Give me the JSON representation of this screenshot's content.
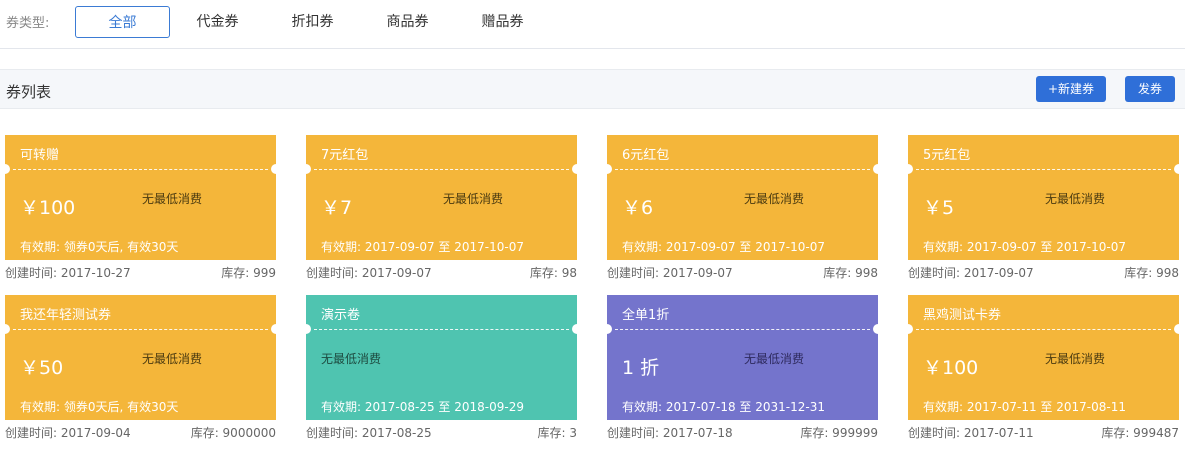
{
  "filter": {
    "label": "券类型:",
    "tabs": [
      "全部",
      "代金券",
      "折扣券",
      "商品券",
      "赠品券"
    ]
  },
  "header": {
    "title": "券列表",
    "new_button": "+新建券",
    "issue_button": "发券"
  },
  "colors": {
    "gold": "#f4b63a",
    "teal": "#4fc4b0",
    "purple": "#7474cc",
    "primary": "#2f6fd8"
  },
  "coupons": [
    {
      "title": "可转赠",
      "amount": "￥100",
      "min_spend": "无最低消费",
      "validity": "有效期:  领券0天后, 有效30天",
      "created": "创建时间: 2017-10-27",
      "stock": "库存: 999",
      "color": "gold"
    },
    {
      "title": "7元红包",
      "amount": "￥7",
      "min_spend": "无最低消费",
      "validity": "有效期:  2017-09-07 至 2017-10-07",
      "created": "创建时间: 2017-09-07",
      "stock": "库存: 98",
      "color": "gold"
    },
    {
      "title": "6元红包",
      "amount": "￥6",
      "min_spend": "无最低消费",
      "validity": "有效期:  2017-09-07 至 2017-10-07",
      "created": "创建时间: 2017-09-07",
      "stock": "库存: 998",
      "color": "gold"
    },
    {
      "title": "5元红包",
      "amount": "￥5",
      "min_spend": "无最低消费",
      "validity": "有效期:  2017-09-07 至 2017-10-07",
      "created": "创建时间: 2017-09-07",
      "stock": "库存: 998",
      "color": "gold"
    },
    {
      "title": "我还年轻测试券",
      "amount": "￥50",
      "min_spend": "无最低消费",
      "validity": "有效期:  领券0天后, 有效30天",
      "created": "创建时间: 2017-09-04",
      "stock": "库存: 9000000",
      "color": "gold"
    },
    {
      "title": "演示卷",
      "amount": "",
      "min_spend": "无最低消费",
      "validity": "有效期:  2017-08-25 至 2018-09-29",
      "created": "创建时间: 2017-08-25",
      "stock": "库存: 3",
      "color": "teal"
    },
    {
      "title": "全单1折",
      "amount": "1 折",
      "min_spend": "无最低消费",
      "validity": "有效期:  2017-07-18 至 2031-12-31",
      "created": "创建时间: 2017-07-18",
      "stock": "库存: 999999",
      "color": "purple"
    },
    {
      "title": "黑鸡测试卡券",
      "amount": "￥100",
      "min_spend": "无最低消费",
      "validity": "有效期:  2017-07-11 至 2017-08-11",
      "created": "创建时间: 2017-07-11",
      "stock": "库存: 999487",
      "color": "gold"
    }
  ]
}
